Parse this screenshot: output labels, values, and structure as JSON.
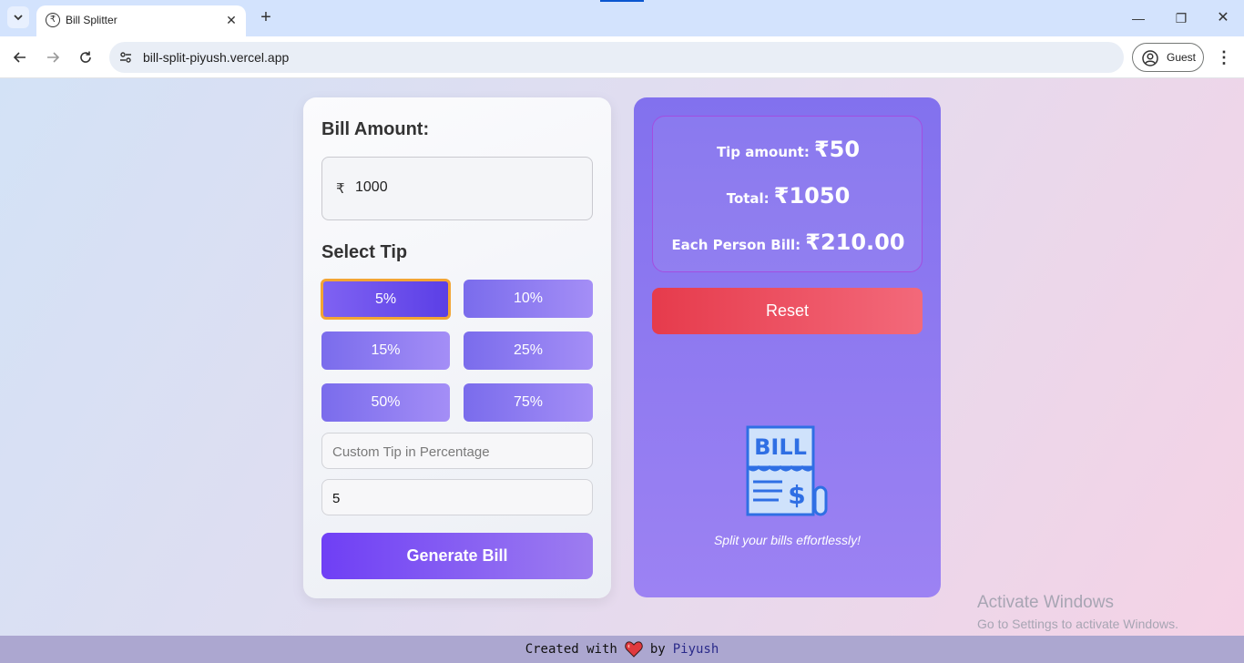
{
  "browser": {
    "tab_title": "Bill Splitter",
    "tab_favicon": "₹",
    "url": "bill-split-piyush.vercel.app",
    "profile_label": "Guest"
  },
  "app": {
    "bill_label": "Bill Amount:",
    "currency_symbol": "₹",
    "bill_value": "1000",
    "tip_label": "Select Tip",
    "tip_options": [
      "5%",
      "10%",
      "15%",
      "25%",
      "50%",
      "75%"
    ],
    "selected_tip": "5%",
    "custom_tip_placeholder": "Custom Tip in Percentage",
    "people_value": "5",
    "generate_label": "Generate Bill",
    "summary": {
      "tip_label": "Tip amount:",
      "tip_value": "₹50",
      "total_label": "Total:",
      "total_value": "₹1050",
      "each_label": "Each Person Bill:",
      "each_value": "₹210.00"
    },
    "reset_label": "Reset",
    "illustration_text": "BILL",
    "tagline": "Split your bills effortlessly!",
    "footer": {
      "prefix": "Created with",
      "suffix": "by",
      "author": "Piyush"
    }
  },
  "windows_watermark": {
    "title": "Activate Windows",
    "subtitle": "Go to Settings to activate Windows."
  },
  "colors": {
    "accent_purple": "#7a6cec",
    "selected_border": "#f3a534",
    "reset_red": "#e63b4c",
    "footer_bg": "#aca7d0"
  }
}
